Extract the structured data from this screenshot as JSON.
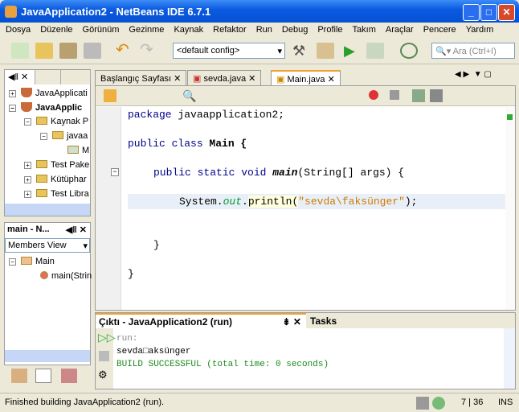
{
  "window": {
    "title": "JavaApplication2 - NetBeans IDE 6.7.1"
  },
  "menu": [
    "Dosya",
    "Düzenle",
    "Görünüm",
    "Gezinme",
    "Kaynak",
    "Refaktor",
    "Run",
    "Debug",
    "Profile",
    "Takım",
    "Araçlar",
    "Pencere",
    "Yardım"
  ],
  "toolbar": {
    "config": "<default config>",
    "search_placeholder": "Ara (Ctrl+I)"
  },
  "projects": {
    "items": [
      "JavaApplicati",
      "JavaApplic",
      "Kaynak P",
      "javaa",
      "M",
      "Test Pake",
      "Kütüphar",
      "Test Libra"
    ]
  },
  "navigator": {
    "title": "main - N...",
    "view": "Members View",
    "items": [
      "Main",
      "main(Strin"
    ]
  },
  "editor": {
    "tabs": [
      "Başlangıç Sayfası",
      "sevda.java",
      "Main.java"
    ],
    "lines": {
      "l1a": "package ",
      "l1b": "javaapplication2;",
      "l2a": "public class ",
      "l2b": "Main {",
      "l3a": "public static void ",
      "l3b": "main",
      "l3c": "(String[] args) {",
      "l4a": "System.",
      "l4b": "out",
      "l4c": ".",
      "l4d": "println",
      "l4e": "(",
      "l4f": "\"sevda\\faksünger\"",
      "l4g": ");",
      "l5": "}",
      "l6": "}"
    }
  },
  "output": {
    "title": "Çıktı - JavaApplication2 (run)",
    "tasks": "Tasks",
    "lines": [
      "run:",
      "sevda□aksünger",
      "BUILD SUCCESSFUL (total time: 0 seconds)"
    ]
  },
  "status": {
    "message": "Finished building JavaApplication2 (run).",
    "position": "7 | 36",
    "mode": "INS"
  }
}
